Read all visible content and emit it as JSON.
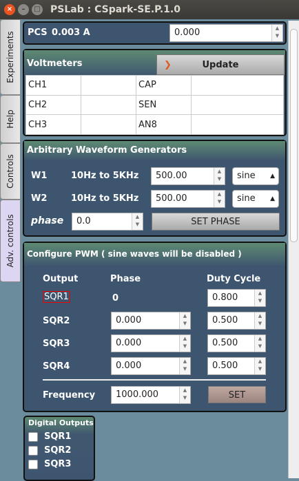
{
  "window": {
    "title": "PSLab : CSpark-SE.P.1.0"
  },
  "tabs": [
    {
      "label": "Experiments"
    },
    {
      "label": "Help"
    },
    {
      "label": "Controls"
    },
    {
      "label": "Adv. controls"
    }
  ],
  "pcs": {
    "label": "PCS",
    "reading": "0.003 A",
    "value": "0.000"
  },
  "voltmeters": {
    "title": "Voltmeters",
    "update_label": "Update",
    "rows": [
      [
        "CH1",
        "",
        "CAP",
        ""
      ],
      [
        "CH2",
        "",
        "SEN",
        ""
      ],
      [
        "CH3",
        "",
        "AN8",
        ""
      ]
    ]
  },
  "awg": {
    "title": "Arbitrary Waveform Generators",
    "w1": {
      "label": "W1",
      "range": "10Hz to 5KHz",
      "value": "500.00",
      "wave": "sine"
    },
    "w2": {
      "label": "W2",
      "range": "10Hz to 5KHz",
      "value": "500.00",
      "wave": "sine"
    },
    "phase_label": "phase",
    "phase_value": "0.0",
    "set_phase_label": "SET PHASE"
  },
  "pwm": {
    "title": "Configure PWM ( sine waves will be disabled )",
    "col_output": "Output",
    "col_phase": "Phase",
    "col_duty": "Duty Cycle",
    "rows": [
      {
        "name": "SQR1",
        "phase": "0",
        "duty": "0.800"
      },
      {
        "name": "SQR2",
        "phase": "0.000",
        "duty": "0.500"
      },
      {
        "name": "SQR3",
        "phase": "0.000",
        "duty": "0.500"
      },
      {
        "name": "SQR4",
        "phase": "0.000",
        "duty": "0.500"
      }
    ],
    "freq_label": "Frequency",
    "freq_value": "1000.000",
    "set_label": "SET"
  },
  "digital": {
    "title": "Digital Outputs",
    "items": [
      "SQR1",
      "SQR2",
      "SQR3"
    ]
  }
}
